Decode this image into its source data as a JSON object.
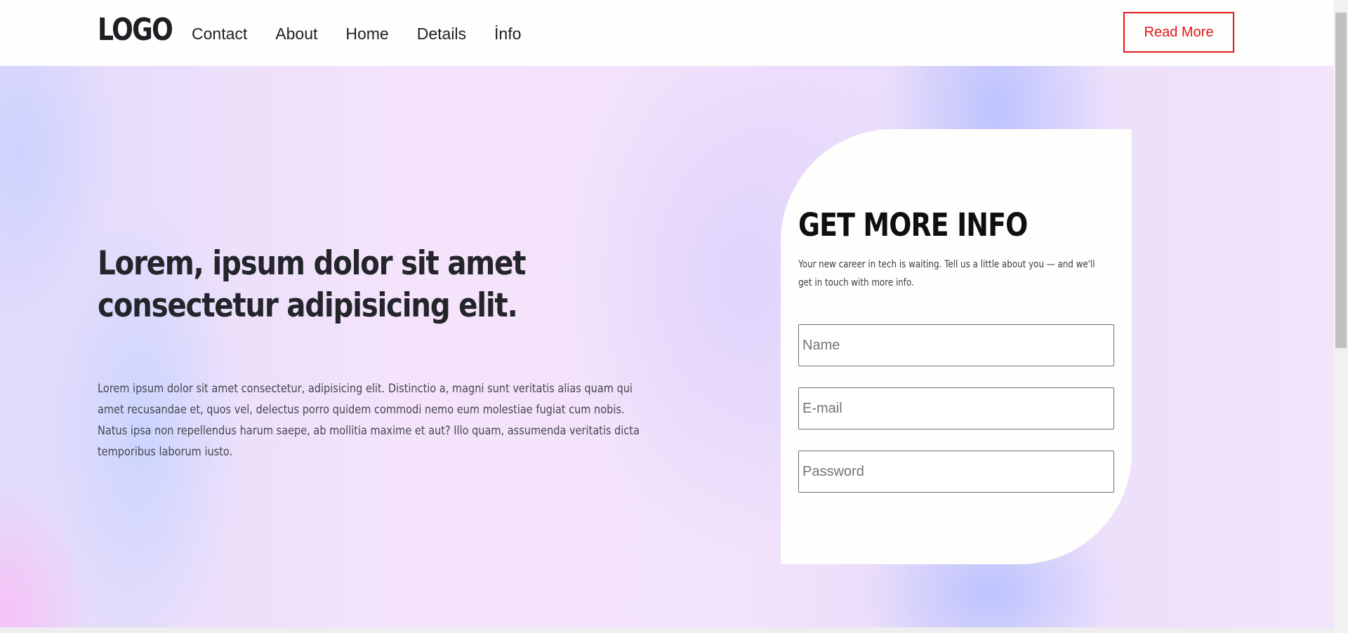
{
  "header": {
    "logo": "LOGO",
    "nav": [
      {
        "label": "Contact"
      },
      {
        "label": "About"
      },
      {
        "label": "Home"
      },
      {
        "label": "Details"
      },
      {
        "label": "İnfo"
      }
    ],
    "read_more_label": "Read More"
  },
  "hero": {
    "title": "Lorem, ipsum dolor sit amet consectetur adipisicing elit.",
    "body": "Lorem ipsum dolor sit amet consectetur, adipisicing elit. Distinctio a, magni sunt veritatis alias quam qui amet recusandae et, quos vel, delectus porro quidem commodi nemo eum molestiae fugiat cum nobis. Natus ipsa non repellendus harum saepe, ab mollitia maxime et aut? Illo quam, assumenda veritatis dicta temporibus laborum iusto."
  },
  "form": {
    "title": "GET MORE INFO",
    "description": "Your new career in tech is waiting. Tell us a little about you — and we'll get in touch with more info.",
    "name_placeholder": "Name",
    "email_placeholder": "E-mail",
    "password_placeholder": "Password"
  },
  "colors": {
    "accent": "#e0161b",
    "text_dark": "#1d1f24"
  }
}
